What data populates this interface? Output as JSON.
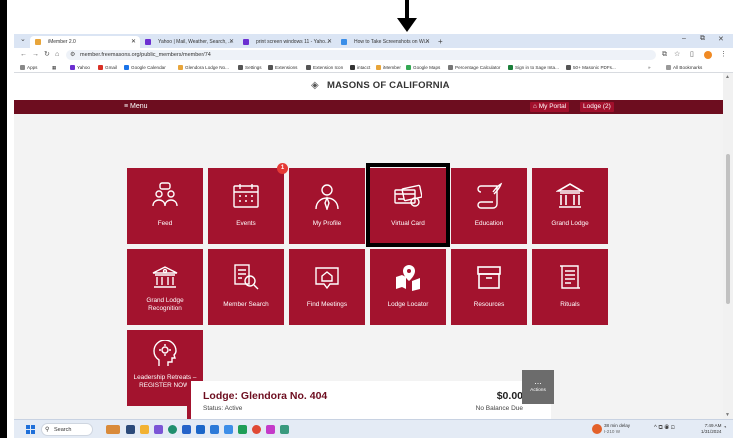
{
  "browser": {
    "tabs": [
      {
        "title": "iMember 2.0",
        "active": true,
        "favicon_color": "#e8a53a"
      },
      {
        "title": "Yahoo | Mail, Weather, Search, ...",
        "active": false,
        "favicon_color": "#6b2fd1"
      },
      {
        "title": "print screen windows 11 - Yaho...",
        "active": false,
        "favicon_color": "#6b2fd1"
      },
      {
        "title": "How to Take Screenshots on Wi...",
        "active": false,
        "favicon_color": "#3a8ee8"
      }
    ],
    "new_tab_icon": "plus-icon",
    "window_controls": [
      "minimize",
      "maximize",
      "close"
    ],
    "url": "member.freemasons.org/public_members/member/74",
    "bookmarks": [
      {
        "label": "Apps",
        "color": "#888888"
      },
      {
        "label": "Yahoo",
        "color": "#6b2fd1"
      },
      {
        "label": "Gmail",
        "color": "#d93025"
      },
      {
        "label": "Google Calendar",
        "color": "#1a73e8"
      },
      {
        "label": "Glendora Lodge No...",
        "color": "#e8a53a"
      },
      {
        "label": "Settings",
        "color": "#555555"
      },
      {
        "label": "Extensions",
        "color": "#555555"
      },
      {
        "label": "Extension Icon",
        "color": "#555555"
      },
      {
        "label": "intacct",
        "color": "#333333"
      },
      {
        "label": "iMember",
        "color": "#e8a53a"
      },
      {
        "label": "Google Maps",
        "color": "#34a853"
      },
      {
        "label": "Percentage Calculator",
        "color": "#777777"
      },
      {
        "label": "Sign in to Sage Inta...",
        "color": "#1b7f3a"
      },
      {
        "label": "50+ Masonic PDFs...",
        "color": "#555555"
      }
    ],
    "all_bookmarks": "All Bookmarks"
  },
  "site": {
    "title": "MASONS OF CALIFORNIA",
    "menu_label": "≡ Menu",
    "portal_label": "My Portal",
    "lodge_label": "Lodge (2)"
  },
  "tiles": [
    {
      "label": "Feed",
      "icon": "feed-icon"
    },
    {
      "label": "Events",
      "icon": "calendar-icon",
      "badge": "1"
    },
    {
      "label": "My Profile",
      "icon": "profile-icon"
    },
    {
      "label": "Virtual Card",
      "icon": "card-icon"
    },
    {
      "label": "Education",
      "icon": "scroll-icon"
    },
    {
      "label": "Grand Lodge",
      "icon": "temple-icon"
    },
    {
      "label": "Grand Lodge Recognition",
      "icon": "building-icon"
    },
    {
      "label": "Member Search",
      "icon": "search-doc-icon"
    },
    {
      "label": "Find Meetings",
      "icon": "meeting-icon"
    },
    {
      "label": "Lodge Locator",
      "icon": "map-pin-icon"
    },
    {
      "label": "Resources",
      "icon": "archive-icon"
    },
    {
      "label": "Rituals",
      "icon": "ritual-scroll-icon"
    },
    {
      "label": "Leadership Retreats – REGISTER NOW!",
      "icon": "head-idea-icon"
    }
  ],
  "lodge_card": {
    "name": "Lodge: Glendora No. 404",
    "status": "Status: Active",
    "balance": "$0.00",
    "balance_label": "No Balance Due",
    "actions_label": "Actions",
    "actions_dots": "..."
  },
  "taskbar": {
    "search_label": "Search",
    "weather_line1": "38 min delay",
    "weather_line2": "I-210 W",
    "clock_time": "7:49 AM",
    "clock_date": "1/31/2024"
  },
  "colors": {
    "brand_maroon": "#6d0d1f",
    "tile_red": "#a3132e",
    "badge_red": "#e53935"
  }
}
